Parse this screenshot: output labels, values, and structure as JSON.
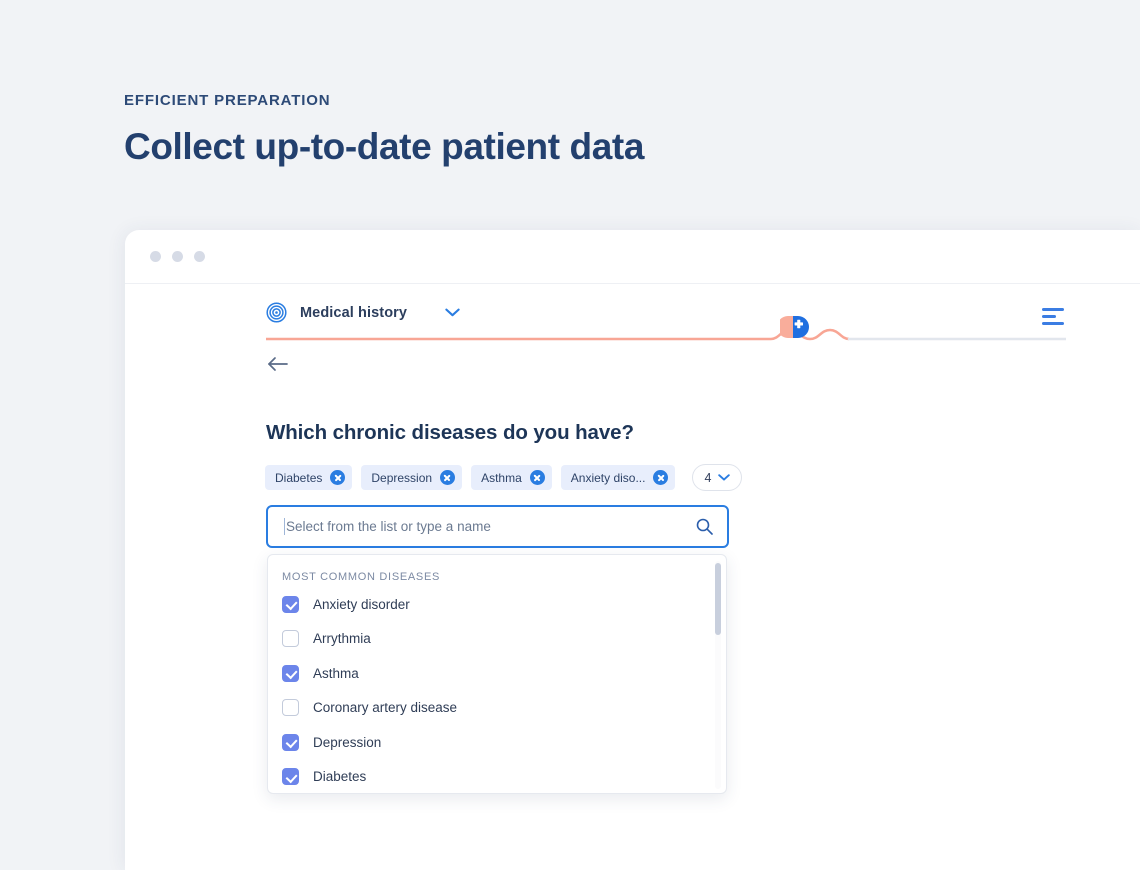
{
  "page": {
    "eyebrow": "EFFICIENT PREPARATION",
    "headline": "Collect up-to-date patient data",
    "background_color": "#f1f3f6"
  },
  "window": {
    "traffic_lights": [
      "dot",
      "dot",
      "dot"
    ],
    "toolbar": {
      "brand_icon": "target-icon",
      "brand_label": "Medical history",
      "brand_chevron_icon": "chevron-down-icon",
      "menu_icon": "hamburger-menu-icon",
      "accent_color": "#3b7de3"
    },
    "progress": {
      "icon": "pill-capsule-icon",
      "filled_color": "#f8a695",
      "track_color": "#e2e6ed",
      "filled_percent": 72
    },
    "back_icon": "back-arrow-icon"
  },
  "form": {
    "question": "Which chronic diseases do you have?",
    "chips": [
      {
        "label": "Diabetes",
        "remove_icon": "close-circle-icon"
      },
      {
        "label": "Depression",
        "remove_icon": "close-circle-icon"
      },
      {
        "label": "Asthma",
        "remove_icon": "close-circle-icon"
      },
      {
        "label": "Anxiety diso...",
        "remove_icon": "close-circle-icon"
      }
    ],
    "counter": {
      "value": "4",
      "chevron_icon": "chevron-down-icon"
    },
    "search": {
      "value": "",
      "placeholder": "Select from the list or type a name",
      "icon": "search-icon",
      "focus_color": "#2a7de1"
    },
    "dropdown": {
      "group_label": "MOST COMMON DISEASES",
      "checkbox_color": "#6c85ea",
      "options": [
        {
          "label": "Anxiety disorder",
          "checked": true
        },
        {
          "label": "Arrythmia",
          "checked": false
        },
        {
          "label": "Asthma",
          "checked": true
        },
        {
          "label": "Coronary artery disease",
          "checked": false
        },
        {
          "label": "Depression",
          "checked": true
        },
        {
          "label": "Diabetes",
          "checked": true
        }
      ]
    }
  }
}
